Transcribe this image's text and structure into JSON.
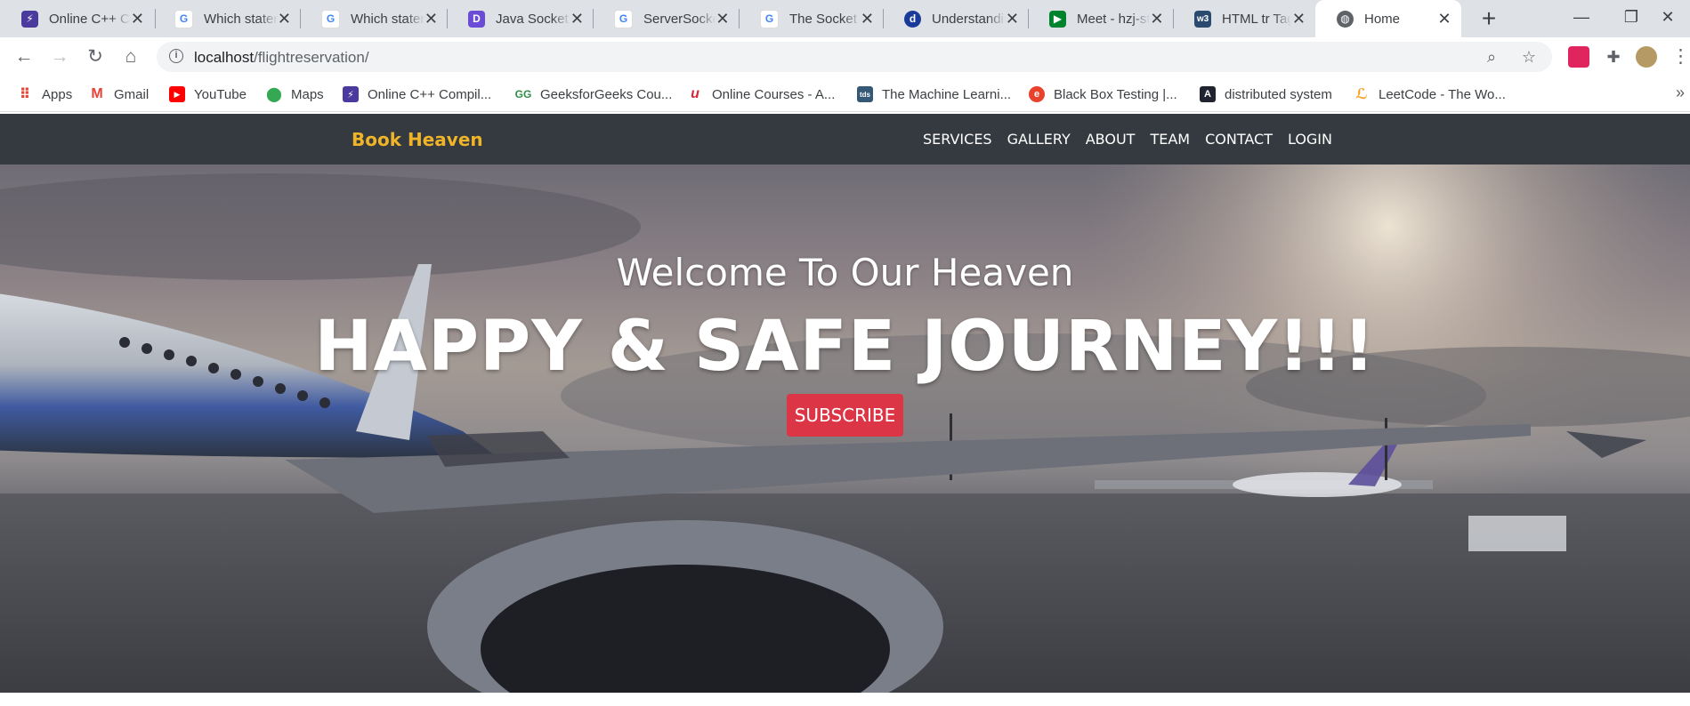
{
  "browser": {
    "tabs": [
      {
        "title": "Online C++ Compiler",
        "favicon": "bolt-icon",
        "color": "#4b3a9e",
        "active": false
      },
      {
        "title": "Which statement",
        "favicon": "google-icon",
        "color": "#4285f4",
        "active": false
      },
      {
        "title": "Which statement",
        "favicon": "google-icon",
        "color": "#4285f4",
        "active": false
      },
      {
        "title": "Java Socket Programming",
        "favicon": "d-icon",
        "color": "#6c4bd6",
        "active": false
      },
      {
        "title": "ServerSocket",
        "favicon": "google-icon",
        "color": "#4285f4",
        "active": false
      },
      {
        "title": "The Socket class",
        "favicon": "google-icon",
        "color": "#4285f4",
        "active": false
      },
      {
        "title": "Understanding",
        "favicon": "d-circle-icon",
        "color": "#1a3a9a",
        "active": false
      },
      {
        "title": "Meet - hzj-stu",
        "favicon": "meet-icon",
        "color": "#00832d",
        "active": false
      },
      {
        "title": "HTML tr Tag",
        "favicon": "w3-icon",
        "color": "#2b4a6f",
        "active": false
      },
      {
        "title": "Home",
        "favicon": "globe-icon",
        "color": "#5f6368",
        "active": true
      }
    ],
    "url_host": "localhost",
    "url_path": "/flightreservation/"
  },
  "bookmarks": [
    {
      "label": "Apps",
      "icon": "apps-grid-icon",
      "color": "#ea4335"
    },
    {
      "label": "Gmail",
      "icon": "gmail-icon",
      "color": "#ea4335"
    },
    {
      "label": "YouTube",
      "icon": "youtube-icon",
      "color": "#ff0000"
    },
    {
      "label": "Maps",
      "icon": "maps-pin-icon",
      "color": "#34a853"
    },
    {
      "label": "Online C++ Compil...",
      "icon": "bolt-icon",
      "color": "#4b3a9e"
    },
    {
      "label": "GeeksforGeeks Cou...",
      "icon": "gfg-icon",
      "color": "#2f8d46"
    },
    {
      "label": "Online Courses - A...",
      "icon": "udemy-icon",
      "color": "#d9263a"
    },
    {
      "label": "The Machine Learni...",
      "icon": "tds-icon",
      "color": "#355876"
    },
    {
      "label": "Black Box Testing |...",
      "icon": "e-circle-icon",
      "color": "#e8412c"
    },
    {
      "label": "distributed system",
      "icon": "a-square-icon",
      "color": "#1f2430"
    },
    {
      "label": "LeetCode - The Wo...",
      "icon": "leetcode-icon",
      "color": "#f89f1b"
    }
  ],
  "site": {
    "brand": "Book Heaven",
    "brand_color": "#f0b429",
    "nav": [
      "SERVICES",
      "GALLERY",
      "ABOUT",
      "TEAM",
      "CONTACT",
      "LOGIN"
    ],
    "hero_subtitle": "Welcome To Our Heaven",
    "hero_title": "HAPPY & SAFE JOURNEY!!!",
    "cta_label": "SUBSCRIBE",
    "cta_color": "#dc3545",
    "navbar_color": "#343a40"
  }
}
